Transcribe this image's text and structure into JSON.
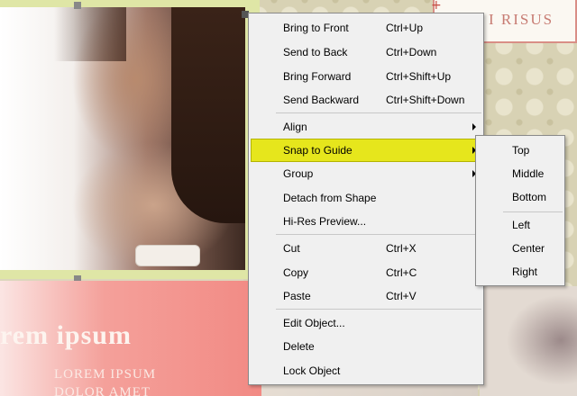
{
  "background": {
    "top_card_text": "I RISUS",
    "top_card_mark": "+",
    "pink_title": "rem ipsum",
    "pink_sub_line1": "LOREM IPSUM",
    "pink_sub_line2": "DOLOR AMET",
    "colors": {
      "highlight": "#e6e61c",
      "pink": "#f28a84",
      "frame": "#dfe6a6"
    }
  },
  "context_menu": {
    "items": [
      {
        "label": "Bring to Front",
        "shortcut": "Ctrl+Up"
      },
      {
        "label": "Send to Back",
        "shortcut": "Ctrl+Down"
      },
      {
        "label": "Bring Forward",
        "shortcut": "Ctrl+Shift+Up"
      },
      {
        "label": "Send Backward",
        "shortcut": "Ctrl+Shift+Down"
      },
      {
        "label": "Align",
        "shortcut": ""
      },
      {
        "label": "Snap to Guide",
        "shortcut": "",
        "highlighted": true
      },
      {
        "label": "Group",
        "shortcut": ""
      },
      {
        "label": "Detach from Shape",
        "shortcut": ""
      },
      {
        "label": "Hi-Res Preview...",
        "shortcut": ""
      },
      {
        "label": "Cut",
        "shortcut": "Ctrl+X"
      },
      {
        "label": "Copy",
        "shortcut": "Ctrl+C"
      },
      {
        "label": "Paste",
        "shortcut": "Ctrl+V"
      },
      {
        "label": "Edit Object...",
        "shortcut": ""
      },
      {
        "label": "Delete",
        "shortcut": ""
      },
      {
        "label": "Lock Object",
        "shortcut": ""
      }
    ]
  },
  "snap_submenu": {
    "items": [
      {
        "label": "Top"
      },
      {
        "label": "Middle"
      },
      {
        "label": "Bottom"
      },
      {
        "label": "Left"
      },
      {
        "label": "Center"
      },
      {
        "label": "Right"
      }
    ]
  }
}
